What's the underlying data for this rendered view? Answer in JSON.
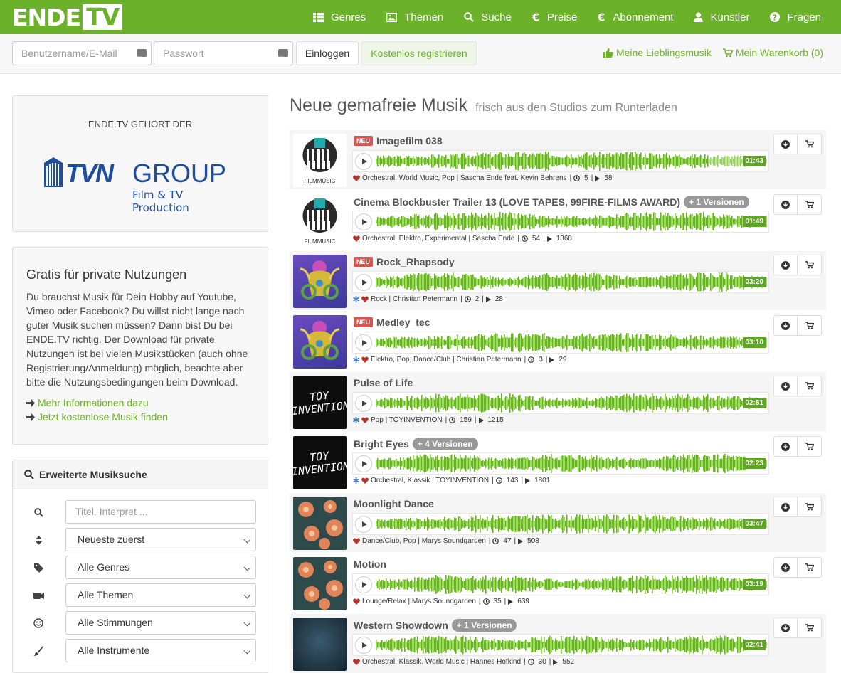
{
  "brand": {
    "logo_a": "ENDE",
    "logo_b": "TV",
    "accent": "#6cb12a"
  },
  "nav": [
    {
      "label": "Genres",
      "icon": "grid-icon"
    },
    {
      "label": "Themen",
      "icon": "image-icon"
    },
    {
      "label": "Suche",
      "icon": "search-icon"
    },
    {
      "label": "Preise",
      "icon": "euro-icon"
    },
    {
      "label": "Abonnement",
      "icon": "euro-icon"
    },
    {
      "label": "Künstler",
      "icon": "user-icon"
    },
    {
      "label": "Fragen",
      "icon": "question-icon"
    }
  ],
  "login": {
    "user_placeholder": "Benutzername/E-Mail",
    "pass_placeholder": "Passwort",
    "login_label": "Einloggen",
    "register_label": "Kostenlos registrieren"
  },
  "header_links": {
    "favorites": "Meine Lieblingsmusik",
    "cart": "Mein Warenkorb (0)"
  },
  "owner": {
    "caption": "ENDE.TV GEHÖRT DER",
    "logo_main": "GROUP",
    "logo_prefix": "TVN",
    "logo_sub": "Film & TV Production"
  },
  "promo": {
    "title": "Gratis für private Nutzungen",
    "text": "Du brauchst Musik für Dein Hobby auf Youtube, Vimeo oder Facebook? Du willst nicht lange nach guter Musik suchen müssen? Dann bist Du bei ENDE.TV richtig. Der Download für private Nutzungen ist bei vielen Musikstücken (auch ohne Registrierung/Anmeldung) möglich, beachte aber bitte die Nutzungsbedingungen beim Download.",
    "link1": "Mehr Informationen dazu",
    "link2": "Jetzt kostenlose Musik finden"
  },
  "search": {
    "title": "Erweiterte Musiksuche",
    "placeholder": "Titel, Interpret ...",
    "sort": "Neueste zuerst",
    "genres": "Alle Genres",
    "themes": "Alle Themen",
    "moods": "Alle Stimmungen",
    "instruments": "Alle Instrumente"
  },
  "main": {
    "title": "Neue gemafreie Musik",
    "subtitle": "frisch aus den Studios zum Runterladen"
  },
  "badge_new": "NEU",
  "tracks": [
    {
      "title": "Imagefilm 038",
      "neu": true,
      "versions": "",
      "duration": "01:43",
      "meta": "Orchestral, World Music, Pop | Sascha Ende feat. Kevin Behrens",
      "likes": "5",
      "plays": "58",
      "star": false,
      "cover": "filmmusic",
      "cover_text": "FILMMUSIC",
      "progress": 0.85
    },
    {
      "title": "Cinema Blockbuster Trailer 13 (LOVE TAPES, 99FIRE-FILMS AWARD)",
      "neu": false,
      "versions": "+ 1 Versionen",
      "duration": "01:49",
      "meta": "Orchestral, Elektro, Experimental | Sascha Ende",
      "likes": "54",
      "plays": "1368",
      "star": false,
      "cover": "filmmusic",
      "cover_text": "FILMMUSIC",
      "progress": 1
    },
    {
      "title": "Rock_Rhapsody",
      "neu": true,
      "versions": "",
      "duration": "03:20",
      "meta": "Rock | Christian Petermann",
      "likes": "2",
      "plays": "28",
      "star": true,
      "cover": "psy",
      "cover_text": "",
      "progress": 1
    },
    {
      "title": "Medley_tec",
      "neu": true,
      "versions": "",
      "duration": "03:10",
      "meta": "Elektro, Pop, Dance/Club | Christian Petermann",
      "likes": "3",
      "plays": "29",
      "star": true,
      "cover": "psy",
      "cover_text": "",
      "progress": 1
    },
    {
      "title": "Pulse of Life",
      "neu": false,
      "versions": "",
      "duration": "02:51",
      "meta": "Pop | TOYINVENTION",
      "likes": "159",
      "plays": "1215",
      "star": true,
      "cover": "toy",
      "cover_text": "TOY INVENTION",
      "progress": 1
    },
    {
      "title": "Bright Eyes",
      "neu": false,
      "versions": "+ 4 Versionen",
      "duration": "02:23",
      "meta": "Orchestral, Klassik | TOYINVENTION",
      "likes": "143",
      "plays": "1801",
      "star": true,
      "cover": "toy",
      "cover_text": "TOY INVENTION",
      "progress": 1
    },
    {
      "title": "Moonlight Dance",
      "neu": false,
      "versions": "",
      "duration": "03:47",
      "meta": "Dance/Club, Pop | Marys Soundgarden",
      "likes": "47",
      "plays": "508",
      "star": false,
      "cover": "flower",
      "cover_text": "",
      "progress": 1
    },
    {
      "title": "Motion",
      "neu": false,
      "versions": "",
      "duration": "03:19",
      "meta": "Lounge/Relax | Marys Soundgarden",
      "likes": "35",
      "plays": "639",
      "star": false,
      "cover": "flower",
      "cover_text": "",
      "progress": 1
    },
    {
      "title": "Western Showdown",
      "neu": false,
      "versions": "+ 1 Versionen",
      "duration": "02:41",
      "meta": "Orchestral, Klassik, World Music | Hannes Hofkind",
      "likes": "30",
      "plays": "552",
      "star": false,
      "cover": "dark",
      "cover_text": "",
      "progress": 1
    }
  ]
}
